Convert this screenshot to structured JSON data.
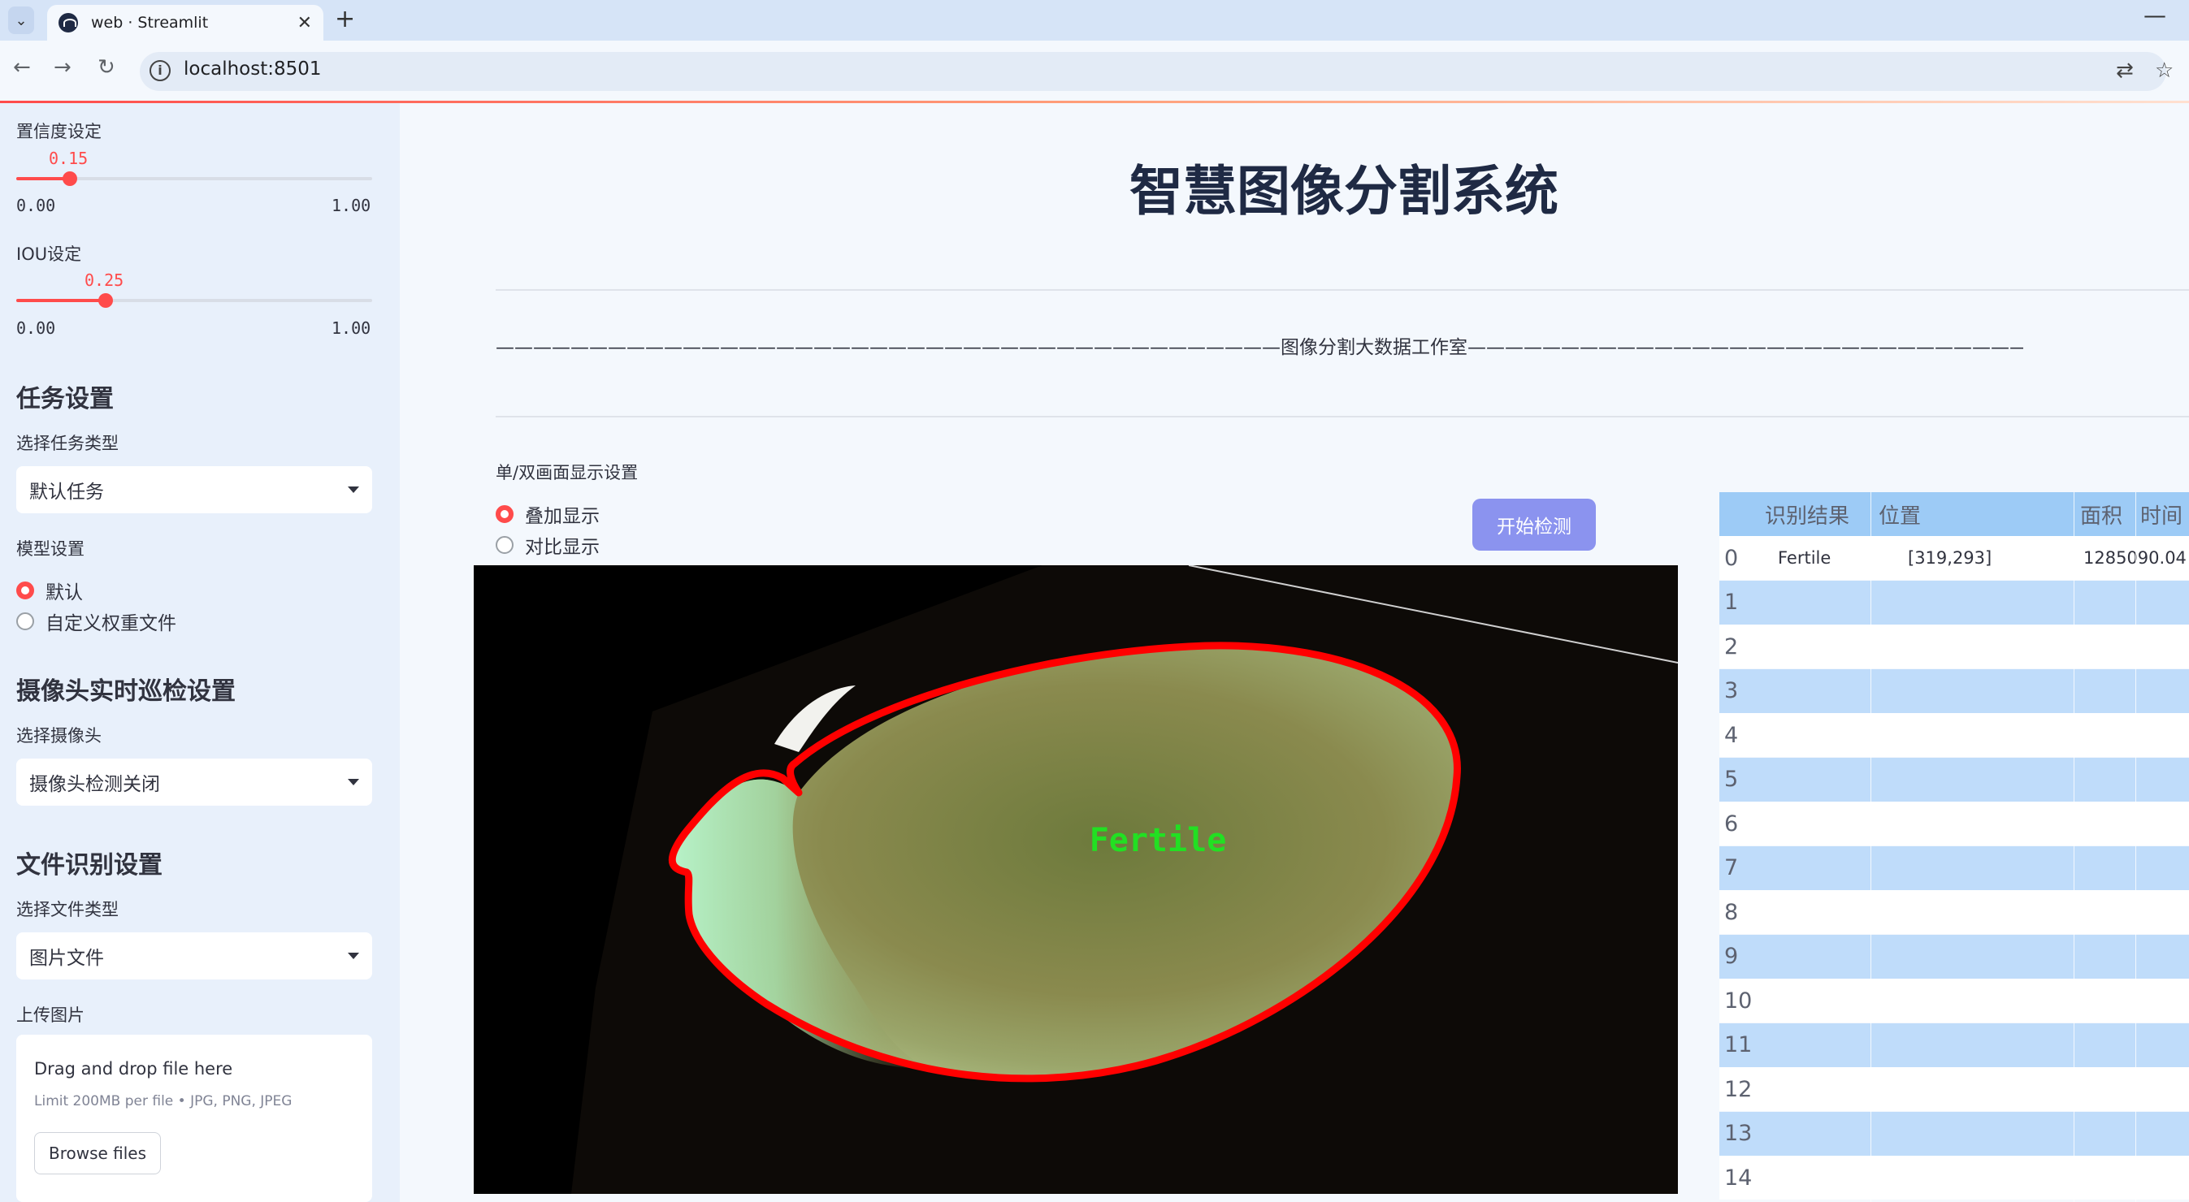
{
  "browser": {
    "tab_title": "web · Streamlit",
    "url": "localhost:8501"
  },
  "sidebar": {
    "confidence": {
      "label": "置信度设定",
      "value": "0.15",
      "value_num": 0.15,
      "min": "0.00",
      "max": "1.00"
    },
    "iou": {
      "label": "IOU设定",
      "value": "0.25",
      "value_num": 0.25,
      "min": "0.00",
      "max": "1.00"
    },
    "task_header": "任务设置",
    "task_type_label": "选择任务类型",
    "task_type_value": "默认任务",
    "model_label": "模型设置",
    "model_options": [
      "默认",
      "自定义权重文件"
    ],
    "model_selected": 0,
    "camera_header": "摄像头实时巡检设置",
    "camera_label": "选择摄像头",
    "camera_value": "摄像头检测关闭",
    "file_header": "文件识别设置",
    "file_type_label": "选择文件类型",
    "file_type_value": "图片文件",
    "upload_label": "上传图片",
    "upload_title": "Drag and drop file here",
    "upload_sub": "Limit 200MB per file • JPG, PNG, JPEG",
    "upload_button": "Browse files"
  },
  "main": {
    "title": "智慧图像分割系统",
    "divider_text": "——————————————————————————————————————————图像分割大数据工作室——————————————————————————————————————————",
    "display_label": "单/双画面显示设置",
    "display_options": [
      "叠加显示",
      "对比显示"
    ],
    "display_selected": 0,
    "detect_button": "开始检测",
    "detection_label": "Fertile"
  },
  "table": {
    "columns": [
      "识别结果",
      "位置",
      "面积",
      "时间"
    ],
    "rows": [
      [
        "0",
        "Fertile",
        "[319,293]",
        "1285090.04",
        ""
      ],
      [
        "1",
        "",
        "",
        "",
        ""
      ],
      [
        "2",
        "",
        "",
        "",
        ""
      ],
      [
        "3",
        "",
        "",
        "",
        ""
      ],
      [
        "4",
        "",
        "",
        "",
        ""
      ],
      [
        "5",
        "",
        "",
        "",
        ""
      ],
      [
        "6",
        "",
        "",
        "",
        ""
      ],
      [
        "7",
        "",
        "",
        "",
        ""
      ],
      [
        "8",
        "",
        "",
        "",
        ""
      ],
      [
        "9",
        "",
        "",
        "",
        ""
      ],
      [
        "10",
        "",
        "",
        "",
        ""
      ],
      [
        "11",
        "",
        "",
        "",
        ""
      ],
      [
        "12",
        "",
        "",
        "",
        ""
      ],
      [
        "13",
        "",
        "",
        "",
        ""
      ],
      [
        "14",
        "",
        "",
        "",
        ""
      ]
    ]
  },
  "colors": {
    "accent": "#ff4b4b",
    "button": "#8b93ef",
    "mask_outline": "#ff0000",
    "label_text": "#22e022"
  }
}
